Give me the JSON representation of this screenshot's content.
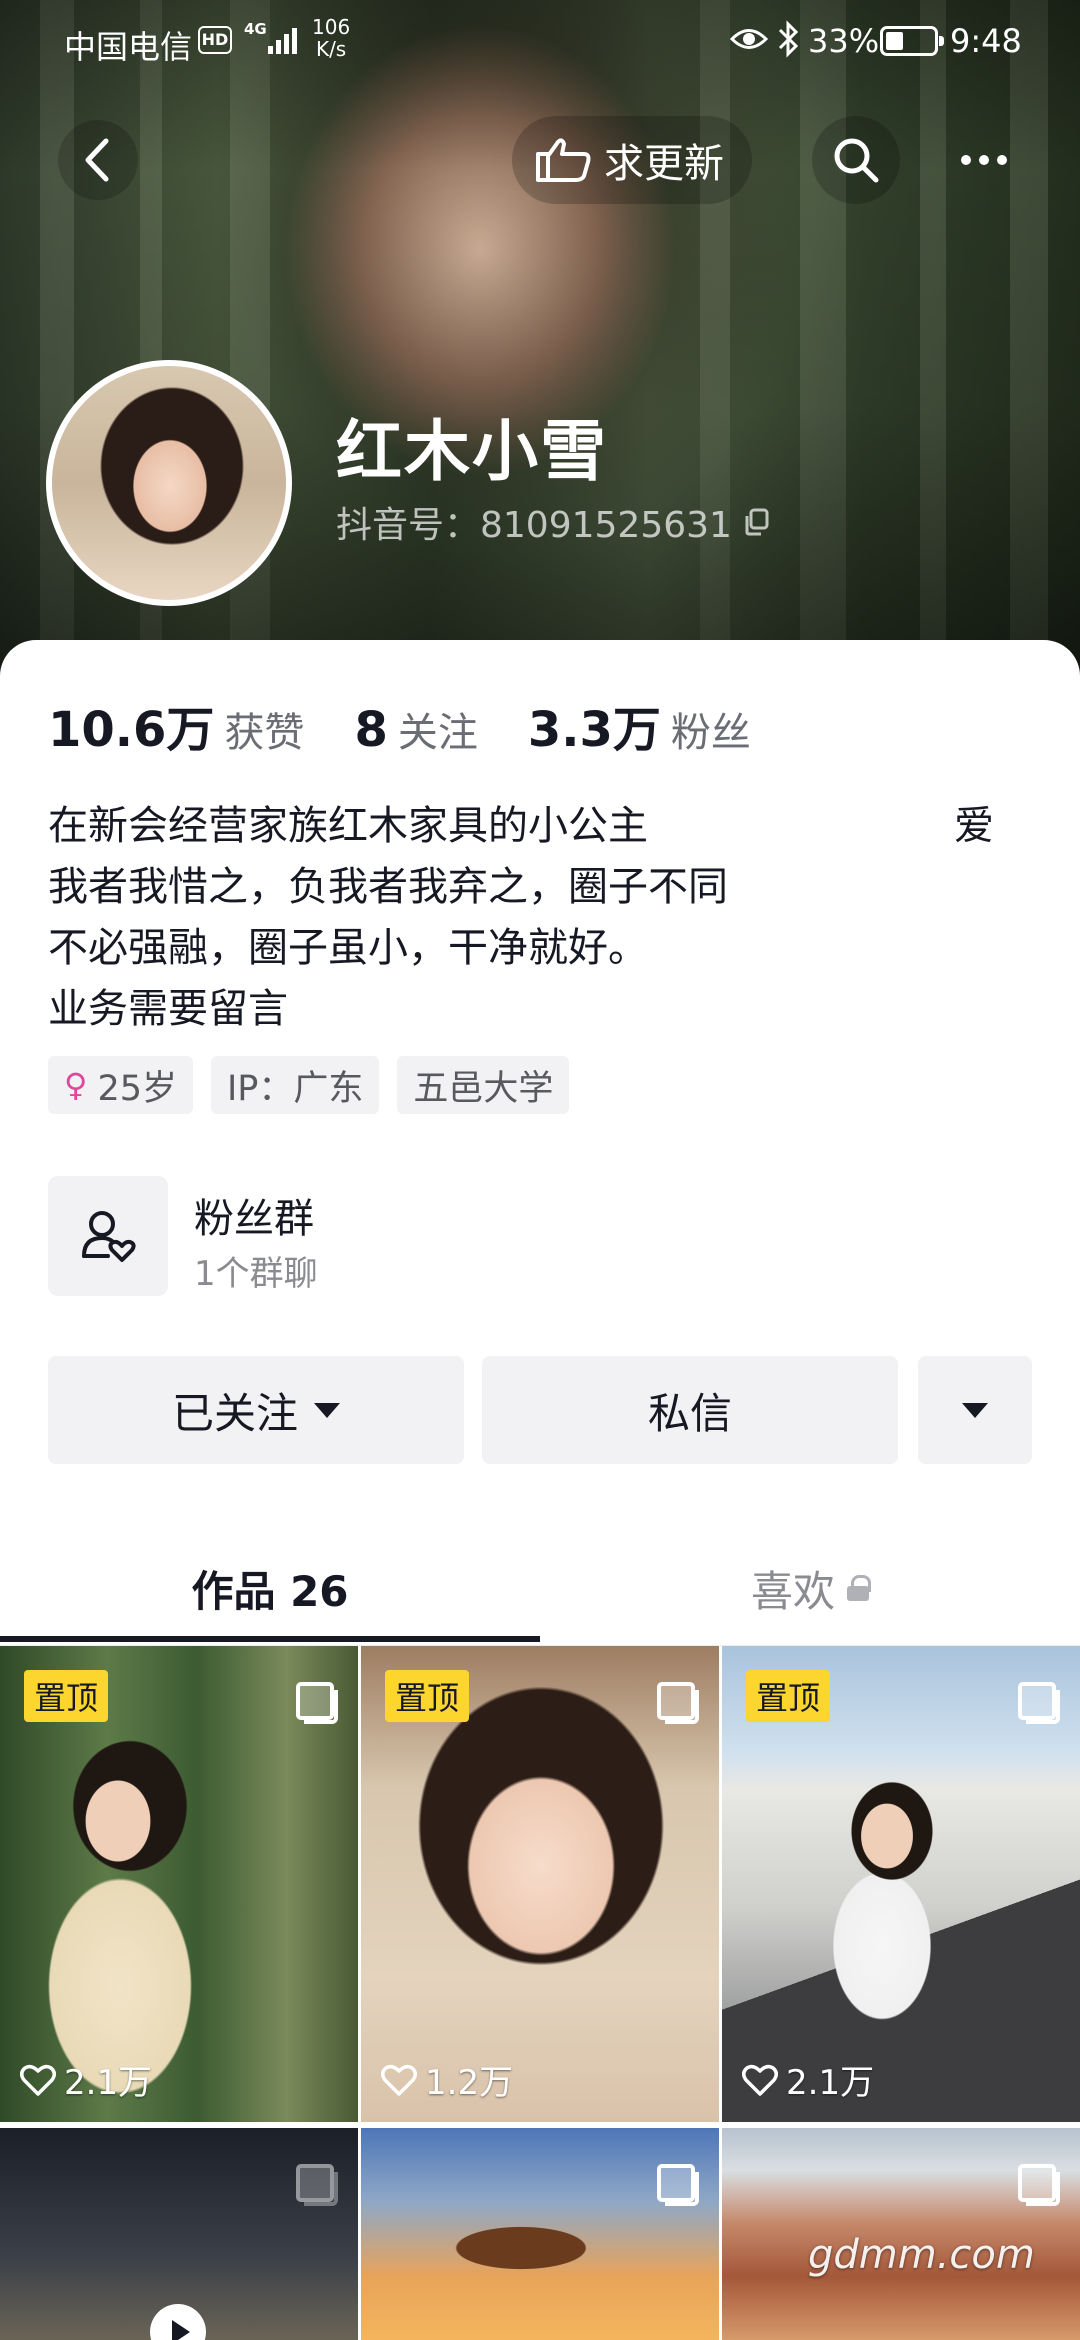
{
  "status_bar": {
    "carrier": "中国电信",
    "hd": "HD",
    "network_type": "4G",
    "speed_value": "106",
    "speed_unit": "K/s",
    "battery_percent": "33%",
    "time": "9:48"
  },
  "header": {
    "update_label": "求更新"
  },
  "profile": {
    "nickname": "红木小雪",
    "douyin_id": "抖音号：81091525631"
  },
  "stats": [
    {
      "value": "10.6万",
      "label": "获赞"
    },
    {
      "value": "8",
      "label": "关注"
    },
    {
      "value": "3.3万",
      "label": "粉丝"
    }
  ],
  "bio": {
    "lines": [
      "在新会经营家族红木家具的小公主",
      "我者我惜之，负我者我弃之，圈子不同",
      "不必强融，圈子虽小，干净就好。",
      "业务需要留言"
    ],
    "trailing": "爱"
  },
  "tags": [
    {
      "text": "25岁",
      "icon": "female-icon"
    },
    {
      "text": "IP：广东"
    },
    {
      "text": "五邑大学"
    }
  ],
  "fan_group": {
    "title": "粉丝群",
    "subtitle": "1个群聊"
  },
  "actions": {
    "follow_label": "已关注",
    "message_label": "私信"
  },
  "tabs": {
    "works_label": "作品 26",
    "likes_label": "喜欢"
  },
  "grid": [
    {
      "pinned": "置顶",
      "likes": "2.1万"
    },
    {
      "pinned": "置顶",
      "likes": "1.2万"
    },
    {
      "pinned": "置顶",
      "likes": "2.1万"
    },
    {},
    {},
    {}
  ],
  "watermark": "gdmm.com",
  "colors": {
    "pin_badge": "#fcd62f",
    "text_primary": "#161823",
    "text_secondary": "#8a8b91",
    "button_bg": "#f2f2f4",
    "female_accent": "#e2469c"
  }
}
